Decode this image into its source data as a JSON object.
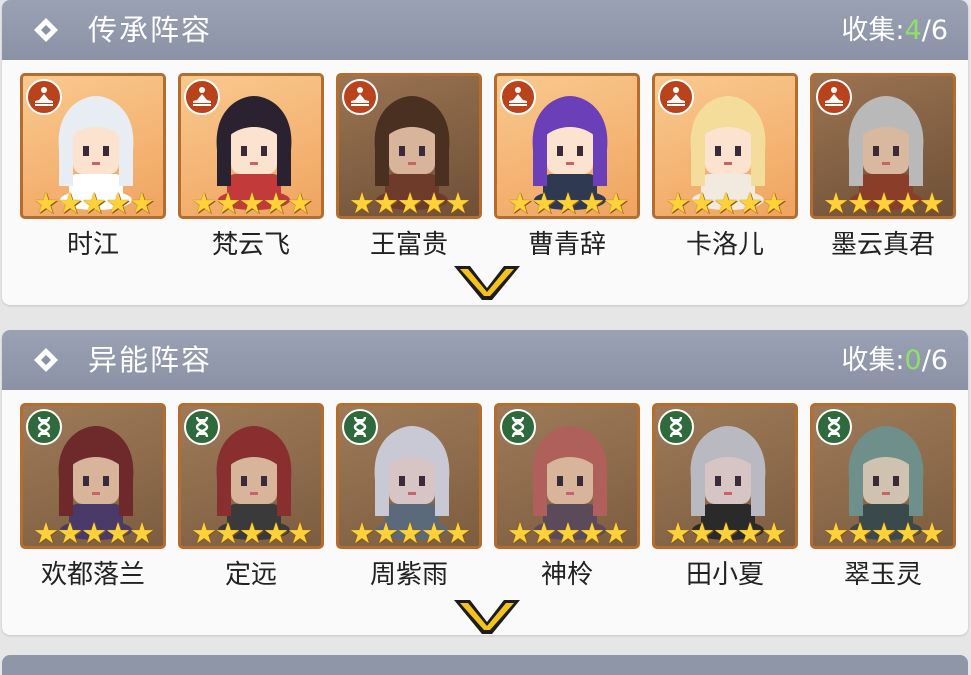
{
  "sections": [
    {
      "title": "传承阵容",
      "collect_label": "收集:",
      "collect_got": "4",
      "collect_total": "/6",
      "badge_icon": "meditation-icon",
      "characters": [
        {
          "name": "时江",
          "stars": 5,
          "collected": true,
          "hair": "#e8ecf3",
          "skin": "#fbe3cf",
          "cloth": "#ffffff"
        },
        {
          "name": "梵云飞",
          "stars": 5,
          "collected": true,
          "hair": "#2a2230",
          "skin": "#fbe3cf",
          "cloth": "#c23a3a"
        },
        {
          "name": "王富贵",
          "stars": 5,
          "collected": false,
          "hair": "#4a3020",
          "skin": "#d7b49a",
          "cloth": "#6e3a2a"
        },
        {
          "name": "曹青辞",
          "stars": 5,
          "collected": true,
          "hair": "#6a3fb8",
          "skin": "#fbe3cf",
          "cloth": "#2f3a52"
        },
        {
          "name": "卡洛儿",
          "stars": 5,
          "collected": true,
          "hair": "#f4dc9a",
          "skin": "#fbe3cf",
          "cloth": "#f3eadf"
        },
        {
          "name": "墨云真君",
          "stars": 5,
          "collected": false,
          "hair": "#b9b9b9",
          "skin": "#d9b8a0",
          "cloth": "#8a3e2a"
        }
      ]
    },
    {
      "title": "异能阵容",
      "collect_label": "收集:",
      "collect_got": "0",
      "collect_total": "/6",
      "badge_icon": "dna-icon",
      "characters": [
        {
          "name": "欢都落兰",
          "stars": 5,
          "collected": false,
          "hair": "#6e2a2a",
          "skin": "#d7b49a",
          "cloth": "#4a3a6a"
        },
        {
          "name": "定远",
          "stars": 5,
          "collected": false,
          "hair": "#8a2f2f",
          "skin": "#d7b49a",
          "cloth": "#3a3a3a"
        },
        {
          "name": "周紫雨",
          "stars": 5,
          "collected": false,
          "hair": "#c9c9d6",
          "skin": "#d7c4c4",
          "cloth": "#5a6a7a"
        },
        {
          "name": "神柃",
          "stars": 5,
          "collected": false,
          "hair": "#b0605a",
          "skin": "#d7b49a",
          "cloth": "#5a4a5a"
        },
        {
          "name": "田小夏",
          "stars": 5,
          "collected": false,
          "hair": "#b9b9c2",
          "skin": "#d7c4c4",
          "cloth": "#2a2a2a"
        },
        {
          "name": "翠玉灵",
          "stars": 5,
          "collected": false,
          "hair": "#6f8f8a",
          "skin": "#cfc2b0",
          "cloth": "#3a4a4a"
        }
      ]
    }
  ],
  "colors": {
    "header_bg": "#8b92a5",
    "collected_count": "#8ee06a",
    "frame_border": "#b56d2f",
    "star": "#ffd23a",
    "expand_chevron": "#f4c21a"
  }
}
